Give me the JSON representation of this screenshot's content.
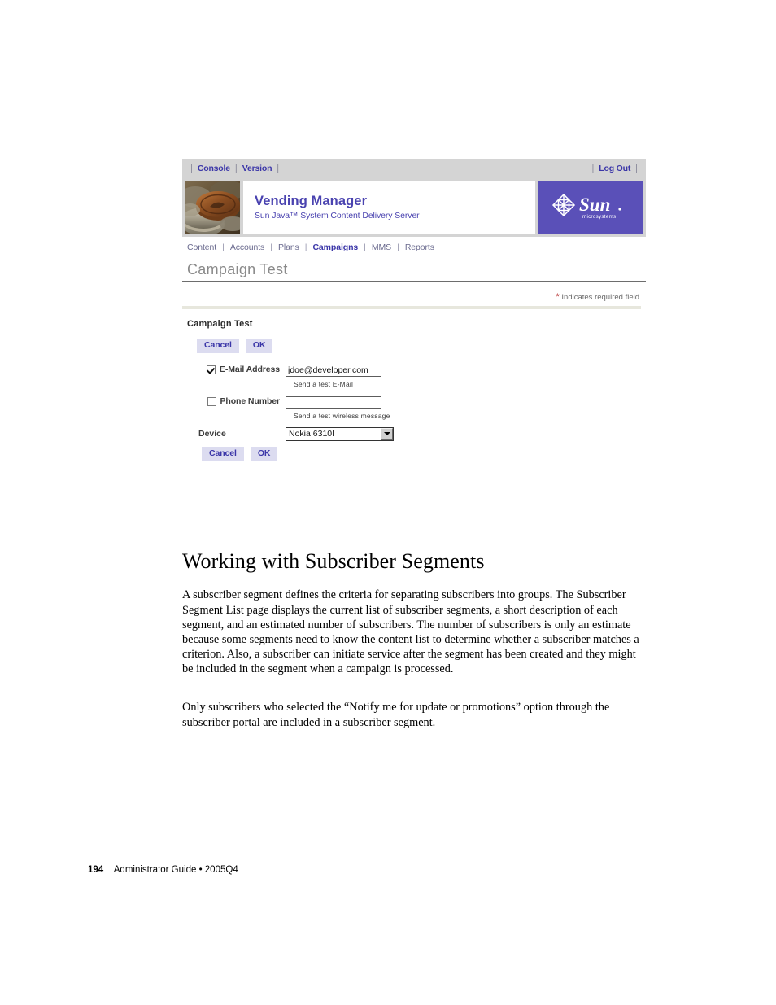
{
  "app": {
    "utility_bar": {
      "console": "Console",
      "version": "Version",
      "logout": "Log Out"
    },
    "brand": {
      "title": "Vending Manager",
      "subtitle": "Sun Java™ System Content Delivery Server",
      "logo_word": "Sun",
      "logo_sub": "microsystems",
      "logo_bg": "#5a50b8",
      "thumbnail_name": "coins-photo"
    },
    "nav": {
      "items": [
        {
          "label": "Content",
          "active": false
        },
        {
          "label": "Accounts",
          "active": false
        },
        {
          "label": "Plans",
          "active": false
        },
        {
          "label": "Campaigns",
          "active": true
        },
        {
          "label": "MMS",
          "active": false
        },
        {
          "label": "Reports",
          "active": false
        }
      ],
      "separator": "|"
    },
    "page": {
      "title": "Campaign Test",
      "required_note": "Indicates required field",
      "required_star": "*",
      "section_label": "Campaign Test"
    },
    "buttons": {
      "cancel": "Cancel",
      "ok": "OK"
    },
    "form": {
      "email": {
        "label": "E-Mail Address",
        "checked": true,
        "value": "jdoe@developer.com",
        "placeholder": "",
        "hint": "Send a test E-Mail"
      },
      "phone": {
        "label": "Phone Number",
        "checked": false,
        "value": "",
        "placeholder": "",
        "hint": "Send a test wireless message"
      },
      "device": {
        "label": "Device",
        "selected": "Nokia 6310I",
        "options": [
          "Nokia 6310I"
        ]
      }
    },
    "colors": {
      "accent_blue": "#3b36a8",
      "button_bg": "#dcdcf0",
      "chrome_gray": "#d4d4d4",
      "required_red": "#b02020"
    }
  },
  "document": {
    "heading": "Working with Subscriber Segments",
    "paragraph1": "A subscriber segment defines the criteria for separating subscribers into groups. The Subscriber Segment List page displays the current list of subscriber segments, a short description of each segment, and an estimated number of subscribers. The number of subscribers is only an estimate because some segments need to know the content list to determine whether a subscriber matches a criterion. Also, a subscriber can initiate service after the segment has been created and they might be included in the segment when a campaign is processed.",
    "paragraph2": "Only subscribers who selected the “Notify me for update or promotions” option through the subscriber portal are included in a subscriber segment.",
    "footer": {
      "page_number": "194",
      "text": "Administrator Guide • 2005Q4"
    }
  }
}
